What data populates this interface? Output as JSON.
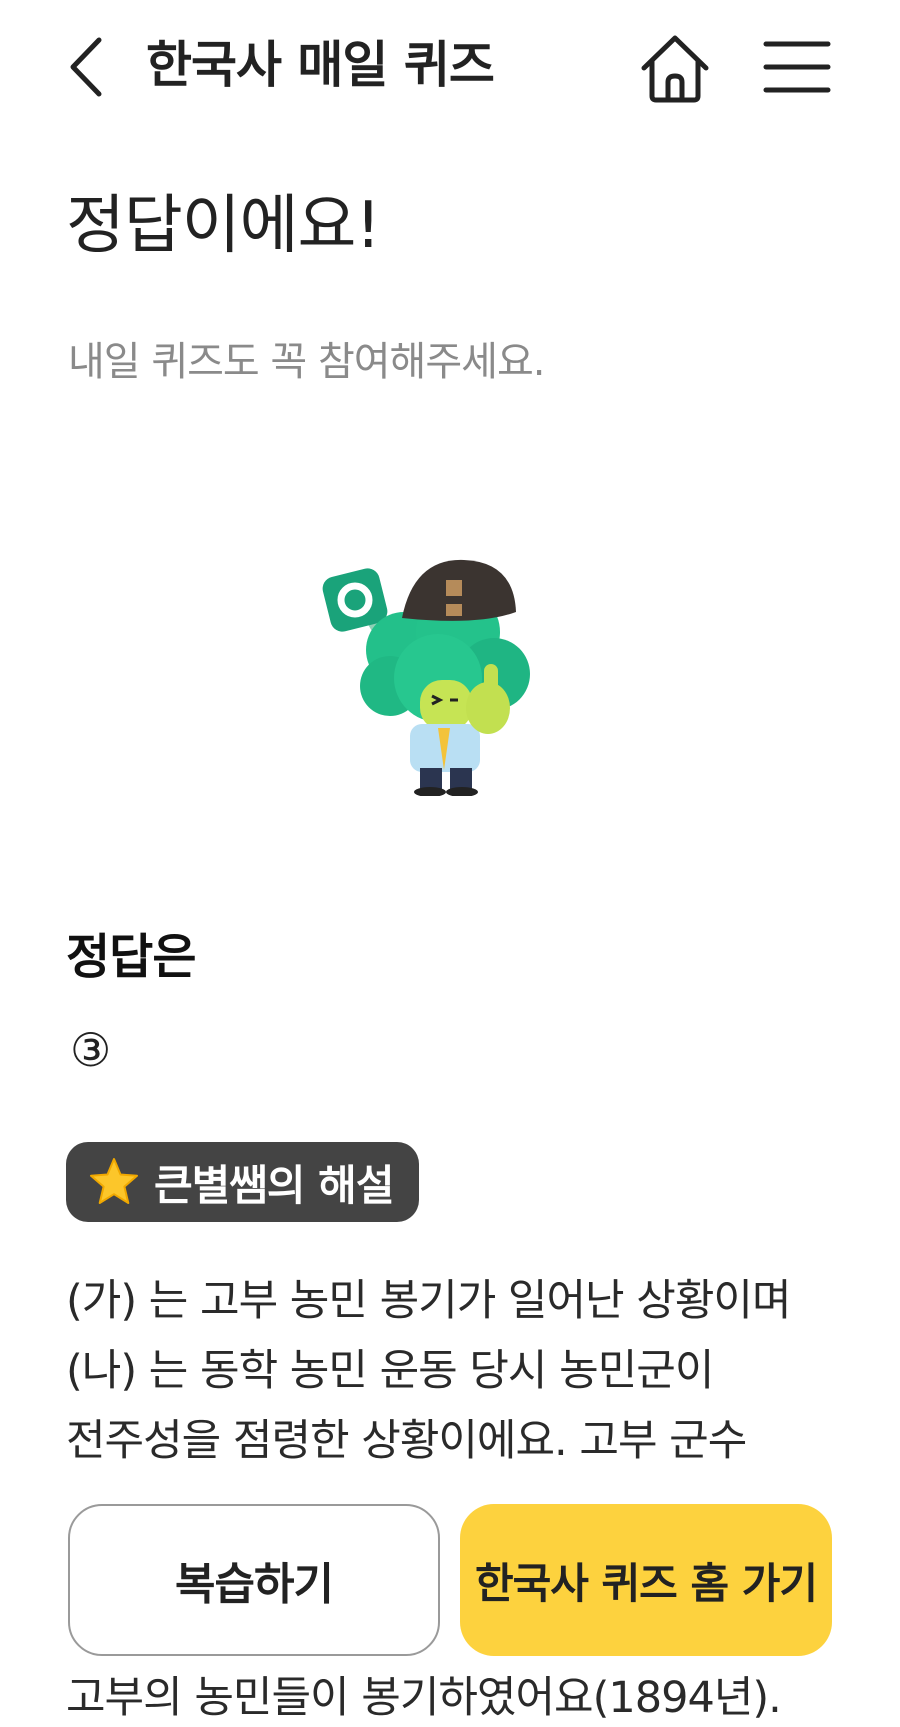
{
  "header": {
    "title": "한국사 매일 퀴즈",
    "back_icon": "chevron-left-icon",
    "home_icon": "home-icon",
    "menu_icon": "hamburger-menu-icon"
  },
  "result": {
    "title": "정답이에요!",
    "subtitle": "내일 퀴즈도 꼭 참여해주세요."
  },
  "answer": {
    "label": "정답은",
    "value": "③"
  },
  "explanation": {
    "badge": "큰별쌤의 해설",
    "badge_icon": "star-icon",
    "lines": [
      "(가) 는 고부 농민 봉기가 일어난 상황이며",
      "(나) 는 동학 농민 운동 당시 농민군이",
      "전주성을 점령한 상황이에요. 고부 군수"
    ],
    "last_line": "고부의 농민들이 봉기하였어요(1894년)."
  },
  "buttons": {
    "review": "복습하기",
    "quiz_home": "한국사 퀴즈 홈 가기"
  },
  "colors": {
    "accent": "#fdd23e",
    "badge_bg": "#444444",
    "mascot_green": "#1fbf82"
  }
}
